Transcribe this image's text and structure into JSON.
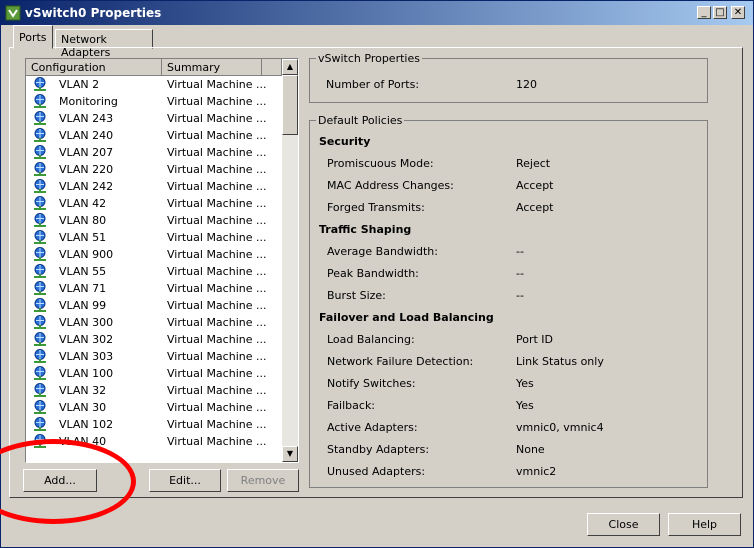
{
  "window": {
    "title": "vSwitch0 Properties",
    "min_glyph": "_",
    "max_glyph": "□",
    "close_glyph": "✕"
  },
  "tabs": [
    {
      "label": "Ports"
    },
    {
      "label": "Network Adapters"
    }
  ],
  "ports_list": {
    "headers": {
      "configuration": "Configuration",
      "summary": "Summary"
    },
    "rows": [
      {
        "name": "VLAN 2",
        "summary": "Virtual Machine ..."
      },
      {
        "name": "Monitoring",
        "summary": "Virtual Machine ..."
      },
      {
        "name": "VLAN 243",
        "summary": "Virtual Machine ..."
      },
      {
        "name": "VLAN 240",
        "summary": "Virtual Machine ..."
      },
      {
        "name": "VLAN 207",
        "summary": "Virtual Machine ..."
      },
      {
        "name": "VLAN 220",
        "summary": "Virtual Machine ..."
      },
      {
        "name": "VLAN 242",
        "summary": "Virtual Machine ..."
      },
      {
        "name": "VLAN 42",
        "summary": "Virtual Machine ..."
      },
      {
        "name": "VLAN 80",
        "summary": "Virtual Machine ..."
      },
      {
        "name": "VLAN 51",
        "summary": "Virtual Machine ..."
      },
      {
        "name": "VLAN 900",
        "summary": "Virtual Machine ..."
      },
      {
        "name": "VLAN 55",
        "summary": "Virtual Machine ..."
      },
      {
        "name": "VLAN 71",
        "summary": "Virtual Machine ..."
      },
      {
        "name": "VLAN 99",
        "summary": "Virtual Machine ..."
      },
      {
        "name": "VLAN 300",
        "summary": "Virtual Machine ..."
      },
      {
        "name": "VLAN 302",
        "summary": "Virtual Machine ..."
      },
      {
        "name": "VLAN 303",
        "summary": "Virtual Machine ..."
      },
      {
        "name": "VLAN 100",
        "summary": "Virtual Machine ..."
      },
      {
        "name": "VLAN 32",
        "summary": "Virtual Machine ..."
      },
      {
        "name": "VLAN 30",
        "summary": "Virtual Machine ..."
      },
      {
        "name": "VLAN 102",
        "summary": "Virtual Machine ..."
      },
      {
        "name": "VLAN 40",
        "summary": "Virtual Machine ..."
      }
    ],
    "icon": "port-group-icon",
    "scroll_up_glyph": "▲",
    "scroll_down_glyph": "▼"
  },
  "buttons": {
    "add": "Add...",
    "edit": "Edit...",
    "remove": "Remove",
    "close": "Close",
    "help": "Help"
  },
  "vswitch_properties": {
    "title": "vSwitch Properties",
    "number_of_ports_label": "Number of Ports:",
    "number_of_ports_value": "120"
  },
  "default_policies": {
    "title": "Default Policies",
    "sections": [
      {
        "heading": "Security",
        "items": [
          {
            "label": "Promiscuous Mode:",
            "value": "Reject"
          },
          {
            "label": "MAC Address Changes:",
            "value": "Accept"
          },
          {
            "label": "Forged Transmits:",
            "value": "Accept"
          }
        ]
      },
      {
        "heading": "Traffic Shaping",
        "items": [
          {
            "label": "Average Bandwidth:",
            "value": "--"
          },
          {
            "label": "Peak Bandwidth:",
            "value": "--"
          },
          {
            "label": "Burst Size:",
            "value": "--"
          }
        ]
      },
      {
        "heading": "Failover and Load Balancing",
        "items": [
          {
            "label": "Load Balancing:",
            "value": "Port ID"
          },
          {
            "label": "Network Failure Detection:",
            "value": "Link Status only"
          },
          {
            "label": "Notify Switches:",
            "value": "Yes"
          },
          {
            "label": "Failback:",
            "value": "Yes"
          },
          {
            "label": "Active Adapters:",
            "value": "vmnic0, vmnic4"
          },
          {
            "label": "Standby Adapters:",
            "value": "None"
          },
          {
            "label": "Unused Adapters:",
            "value": "vmnic2"
          }
        ]
      }
    ]
  },
  "colors": {
    "title_bar": "#0a246a",
    "window_bg": "#d4d0c8",
    "annotation": "#ff0000"
  }
}
